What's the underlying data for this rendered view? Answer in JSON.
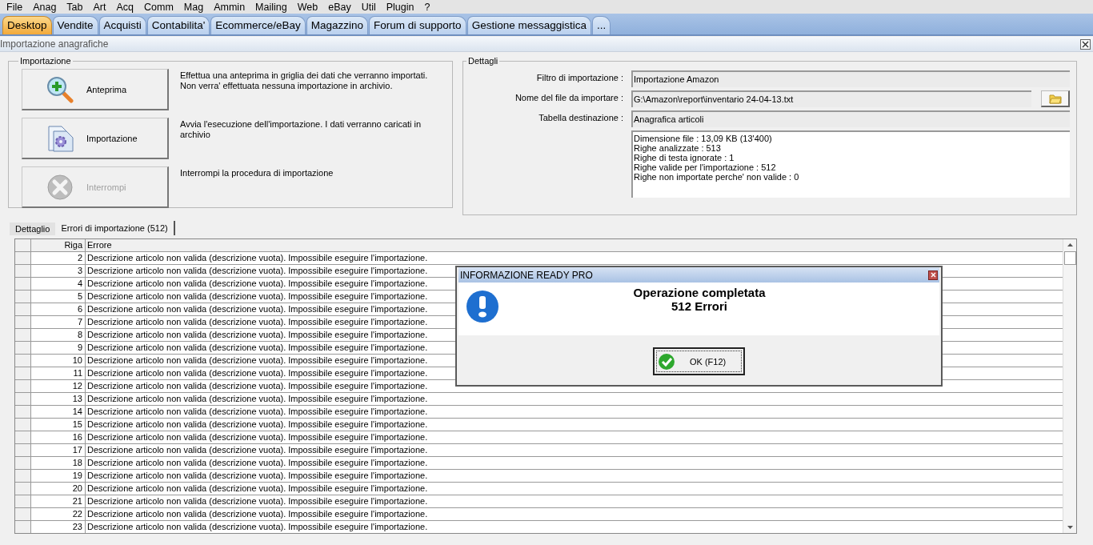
{
  "menu": [
    "File",
    "Anag",
    "Tab",
    "Art",
    "Acq",
    "Comm",
    "Mag",
    "Ammin",
    "Mailing",
    "Web",
    "eBay",
    "Util",
    "Plugin",
    "?"
  ],
  "tabs": [
    {
      "label": "Desktop",
      "selected": true
    },
    {
      "label": "Vendite",
      "selected": false
    },
    {
      "label": "Acquisti",
      "selected": false
    },
    {
      "label": "Contabilita'",
      "selected": false
    },
    {
      "label": "Ecommerce/eBay",
      "selected": false
    },
    {
      "label": "Magazzino",
      "selected": false
    },
    {
      "label": "Forum di supporto",
      "selected": false
    },
    {
      "label": "Gestione messaggistica",
      "selected": false
    },
    {
      "label": "...",
      "selected": false
    }
  ],
  "window": {
    "title": "Importazione anagrafiche"
  },
  "import_group": {
    "title": "Importazione",
    "actions": [
      {
        "kind": "preview",
        "label": "Anteprima",
        "description": "Effettua una anteprima in griglia dei dati che verranno importati. Non verra' effettuata nessuna importazione in archivio.",
        "disabled": false
      },
      {
        "kind": "import",
        "label": "Importazione",
        "description": "Avvia l'esecuzione dell'importazione. I dati verranno caricati in archivio",
        "disabled": false
      },
      {
        "kind": "stop",
        "label": "Interrompi",
        "description": "Interrompi la procedura di importazione",
        "disabled": true
      }
    ]
  },
  "details": {
    "title": "Dettagli",
    "fields": [
      {
        "kind": "text",
        "label": "Filtro di importazione :",
        "value": "Importazione Amazon"
      },
      {
        "kind": "file",
        "label": "Nome del file da importare :",
        "value": "G:\\Amazon\\report\\inventario 24-04-13.txt"
      },
      {
        "kind": "text",
        "label": "Tabella destinazione :",
        "value": "Anagrafica articoli"
      }
    ],
    "summary": [
      "Dimensione file : 13,09 KB (13'400)",
      "Righe analizzate : 513",
      "Righe di testa ignorate : 1",
      "Righe valide per l'importazione : 512",
      "Righe non importate perche' non valide : 0"
    ]
  },
  "detail_tabs": [
    {
      "label": "Dettaglio",
      "selected": false
    },
    {
      "label": "Errori di importazione (512)",
      "selected": true
    }
  ],
  "grid": {
    "columns": [
      "Riga",
      "Errore"
    ],
    "rows": [
      {
        "riga": "2",
        "errore": "Descrizione articolo non valida (descrizione vuota). Impossibile eseguire l'importazione."
      },
      {
        "riga": "3",
        "errore": "Descrizione articolo non valida (descrizione vuota). Impossibile eseguire l'importazione."
      },
      {
        "riga": "4",
        "errore": "Descrizione articolo non valida (descrizione vuota). Impossibile eseguire l'importazione."
      },
      {
        "riga": "5",
        "errore": "Descrizione articolo non valida (descrizione vuota). Impossibile eseguire l'importazione."
      },
      {
        "riga": "6",
        "errore": "Descrizione articolo non valida (descrizione vuota). Impossibile eseguire l'importazione."
      },
      {
        "riga": "7",
        "errore": "Descrizione articolo non valida (descrizione vuota). Impossibile eseguire l'importazione."
      },
      {
        "riga": "8",
        "errore": "Descrizione articolo non valida (descrizione vuota). Impossibile eseguire l'importazione."
      },
      {
        "riga": "9",
        "errore": "Descrizione articolo non valida (descrizione vuota). Impossibile eseguire l'importazione."
      },
      {
        "riga": "10",
        "errore": "Descrizione articolo non valida (descrizione vuota). Impossibile eseguire l'importazione."
      },
      {
        "riga": "11",
        "errore": "Descrizione articolo non valida (descrizione vuota). Impossibile eseguire l'importazione."
      },
      {
        "riga": "12",
        "errore": "Descrizione articolo non valida (descrizione vuota). Impossibile eseguire l'importazione."
      },
      {
        "riga": "13",
        "errore": "Descrizione articolo non valida (descrizione vuota). Impossibile eseguire l'importazione."
      },
      {
        "riga": "14",
        "errore": "Descrizione articolo non valida (descrizione vuota). Impossibile eseguire l'importazione."
      },
      {
        "riga": "15",
        "errore": "Descrizione articolo non valida (descrizione vuota). Impossibile eseguire l'importazione."
      },
      {
        "riga": "16",
        "errore": "Descrizione articolo non valida (descrizione vuota). Impossibile eseguire l'importazione."
      },
      {
        "riga": "17",
        "errore": "Descrizione articolo non valida (descrizione vuota). Impossibile eseguire l'importazione."
      },
      {
        "riga": "18",
        "errore": "Descrizione articolo non valida (descrizione vuota). Impossibile eseguire l'importazione."
      },
      {
        "riga": "19",
        "errore": "Descrizione articolo non valida (descrizione vuota). Impossibile eseguire l'importazione."
      },
      {
        "riga": "20",
        "errore": "Descrizione articolo non valida (descrizione vuota). Impossibile eseguire l'importazione."
      },
      {
        "riga": "21",
        "errore": "Descrizione articolo non valida (descrizione vuota). Impossibile eseguire l'importazione."
      },
      {
        "riga": "22",
        "errore": "Descrizione articolo non valida (descrizione vuota). Impossibile eseguire l'importazione."
      },
      {
        "riga": "23",
        "errore": "Descrizione articolo non valida (descrizione vuota). Impossibile eseguire l'importazione."
      }
    ]
  },
  "dialog": {
    "title": "INFORMAZIONE READY PRO",
    "lines": [
      "Operazione completata",
      "512 Errori"
    ],
    "ok_button": "OK (F12)"
  }
}
